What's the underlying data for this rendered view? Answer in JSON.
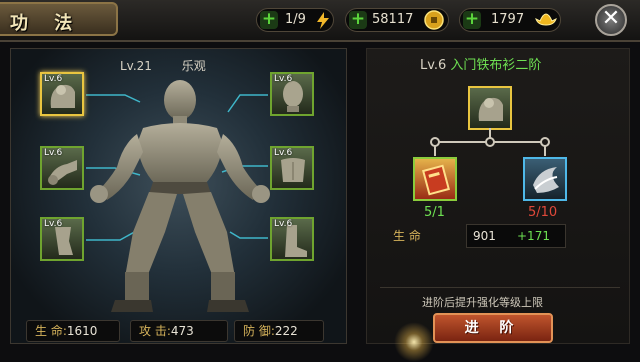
{
  "header": {
    "title": "功 法"
  },
  "resources": {
    "energy": "1/9",
    "coins": "58117",
    "gold": "1797"
  },
  "hero": {
    "level": "Lv.21",
    "state": "乐观"
  },
  "slots": [
    {
      "label": "Lv.6",
      "part": "shoulder",
      "selected": true
    },
    {
      "label": "Lv.6",
      "part": "head",
      "selected": false
    },
    {
      "label": "Lv.6",
      "part": "arm",
      "selected": false
    },
    {
      "label": "Lv.6",
      "part": "torso",
      "selected": false
    },
    {
      "label": "Lv.6",
      "part": "leg",
      "selected": false
    },
    {
      "label": "Lv.6",
      "part": "foot",
      "selected": false
    }
  ],
  "stats": {
    "hp_label": "生 命:",
    "hp_value": "1610",
    "atk_label": "攻 击:",
    "atk_value": "473",
    "def_label": "防 御:",
    "def_value": "222"
  },
  "detail": {
    "level": "Lv.6",
    "name": "入门铁布衫二阶",
    "req_left": "5/1",
    "req_right": "5/10",
    "life_label": "生   命",
    "life_value": "901",
    "life_bonus": "+171",
    "hint": "进阶后提升强化等级上限",
    "advance_label": "进 阶"
  },
  "colors": {
    "accent_green": "#6ee052",
    "warn_red": "#e0483a",
    "gold": "#d6b35b"
  }
}
